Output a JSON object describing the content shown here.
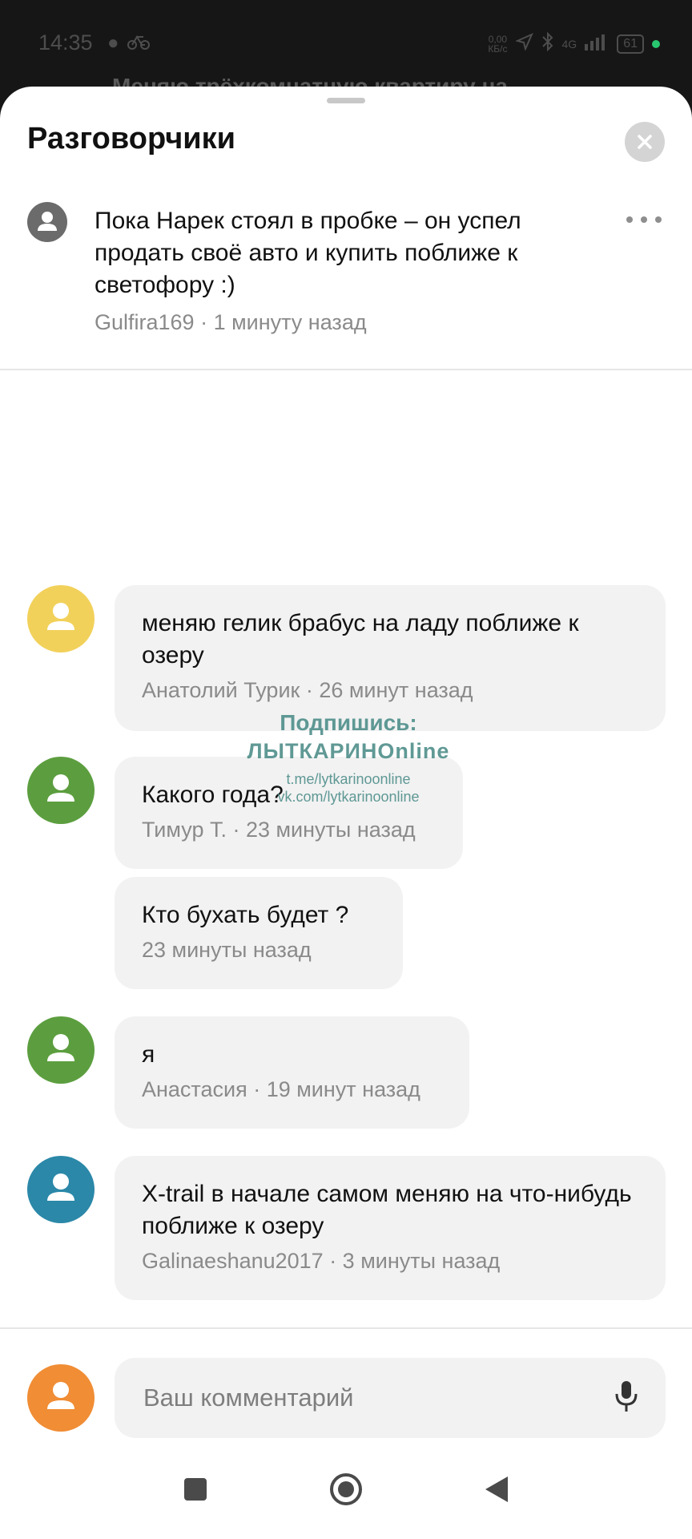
{
  "status_bar": {
    "time": "14:35",
    "net_speed_value": "0,00",
    "net_speed_unit": "КБ/с",
    "network_type": "4G",
    "battery": "61",
    "accent_dot_color": "#28c76f"
  },
  "background_text": "Меняю трёхкомнатную квартиру на...",
  "sheet": {
    "title": "Разговорчики",
    "close_icon": "close-icon"
  },
  "post": {
    "text": "Пока Нарек стоял в пробке – он успел продать своё авто и купить поближе к светофору :)",
    "meta": "Gulfira169 · 1 минуту назад",
    "avatar_color": "#6b6b6b"
  },
  "comments": [
    {
      "text": "меняю гелик брабус на ладу поближе к озеру",
      "meta": "Анатолий Турик · 26 минут назад",
      "avatar_color": "#f2d15b"
    },
    {
      "text": "Какого года?",
      "meta": "Тимур Т. · 23 минуты назад",
      "avatar_color": "#5c9e3f"
    },
    {
      "text": "Кто бухать будет ?",
      "meta": "23 минуты назад",
      "avatar_color": ""
    },
    {
      "text": "я",
      "meta": "Анастасия · 19 минут назад",
      "avatar_color": "#5c9e3f"
    },
    {
      "text": "X-trail в начале самом меняю на что-нибудь поближе к озеру",
      "meta": "Galinaeshanu2017 · 3 минуты назад",
      "avatar_color": "#2b88a8"
    }
  ],
  "watermark": {
    "line1": "Подпишись:",
    "line2": "ЛЫТКАРИНОnline",
    "link1": "t.me/lytkarinoonline",
    "link2": "vk.com/lytkarinoonline"
  },
  "composer": {
    "placeholder": "Ваш комментарий",
    "avatar_color": "#f08d35",
    "mic_icon": "microphone-icon"
  },
  "nav": {
    "recents_icon": "square-icon",
    "home_icon": "circle-icon",
    "back_icon": "triangle-back-icon"
  }
}
